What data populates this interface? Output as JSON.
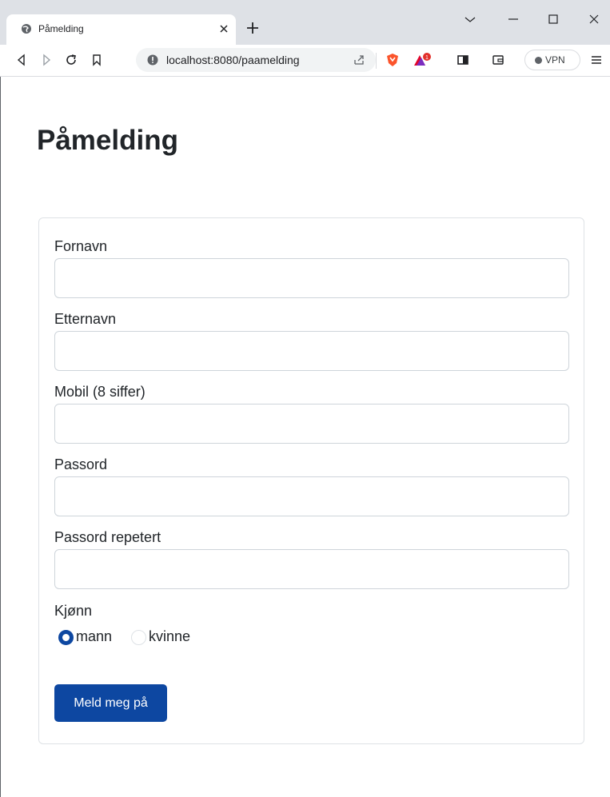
{
  "browser": {
    "tab_title": "Påmelding",
    "url": "localhost:8080/paamelding",
    "vpn_label": "VPN",
    "brave_badge_count": "1"
  },
  "page": {
    "title": "Påmelding"
  },
  "form": {
    "fields": [
      {
        "label": "Fornavn",
        "value": "",
        "placeholder": ""
      },
      {
        "label": "Etternavn",
        "value": "",
        "placeholder": ""
      },
      {
        "label": "Mobil (8 siffer)",
        "value": "",
        "placeholder": ""
      },
      {
        "label": "Passord",
        "value": "",
        "placeholder": ""
      },
      {
        "label": "Passord repetert",
        "value": "",
        "placeholder": ""
      }
    ],
    "gender": {
      "label": "Kjønn",
      "options": [
        {
          "label": "mann",
          "checked": true
        },
        {
          "label": "kvinne",
          "checked": false
        }
      ]
    },
    "submit_label": "Meld meg på"
  },
  "colors": {
    "primary": "#0d47a1",
    "tabbar": "#dee1e6"
  }
}
